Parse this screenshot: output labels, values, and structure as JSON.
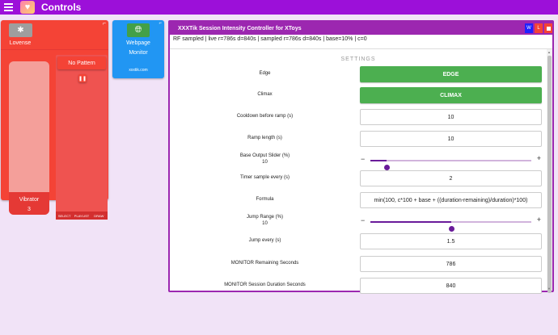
{
  "app": {
    "title": "Controls"
  },
  "lovense": {
    "name": "Lovense",
    "bluetooth_icon": "bluetooth-icon",
    "vibrator_label": "Vibrator",
    "vibrator_value": "3",
    "vibrator_level": 0.15,
    "pattern_label": "No Pattern",
    "pause_icon": "pause-icon",
    "tabs": [
      "SELECT",
      "PLAYLIST",
      "DRAW"
    ],
    "color": "#f44336"
  },
  "webmon": {
    "name_line1": "Webpage",
    "name_line2": "Monitor",
    "site": "xxxtik.com",
    "globe_icon": "globe-icon",
    "color": "#2196f3"
  },
  "panel": {
    "title": "XXXTik Session Intensity Controller for XToys",
    "btn_w": "W",
    "btn_l": "L",
    "status": "RF sampled | live r=786s d=840s | sampled r=786s d=840s | base=10% | c=0",
    "section": "SETTINGS",
    "accent": "#9c27b0"
  },
  "settings": {
    "edge": {
      "label": "Edge",
      "button": "EDGE"
    },
    "climax": {
      "label": "Climax",
      "button": "CLIMAX"
    },
    "cooldown": {
      "label": "Cooldown before ramp (s)",
      "value": "10"
    },
    "ramp": {
      "label": "Ramp length (s)",
      "value": "10"
    },
    "base_output": {
      "label": "Base Output Slider (%)",
      "value": "10",
      "min": "−",
      "max": "+",
      "level": 0.1
    },
    "timer": {
      "label": "Timer sample every (s)",
      "value": "2"
    },
    "formula": {
      "label": "Formula",
      "value": "min(100, c*100 + base + ((duration-remaining)/duration)*100)"
    },
    "jump_range": {
      "label": "Jump Range (%)",
      "value": "10",
      "min": "−",
      "max": "+",
      "level": 0.5
    },
    "jump_every": {
      "label": "Jump every (s)",
      "value": "1.5"
    },
    "monitor_remaining": {
      "label": "MONITOR Remaining Seconds",
      "value": "786"
    },
    "monitor_duration": {
      "label": "MONITOR Session Duration Seconds",
      "value": "840"
    }
  }
}
